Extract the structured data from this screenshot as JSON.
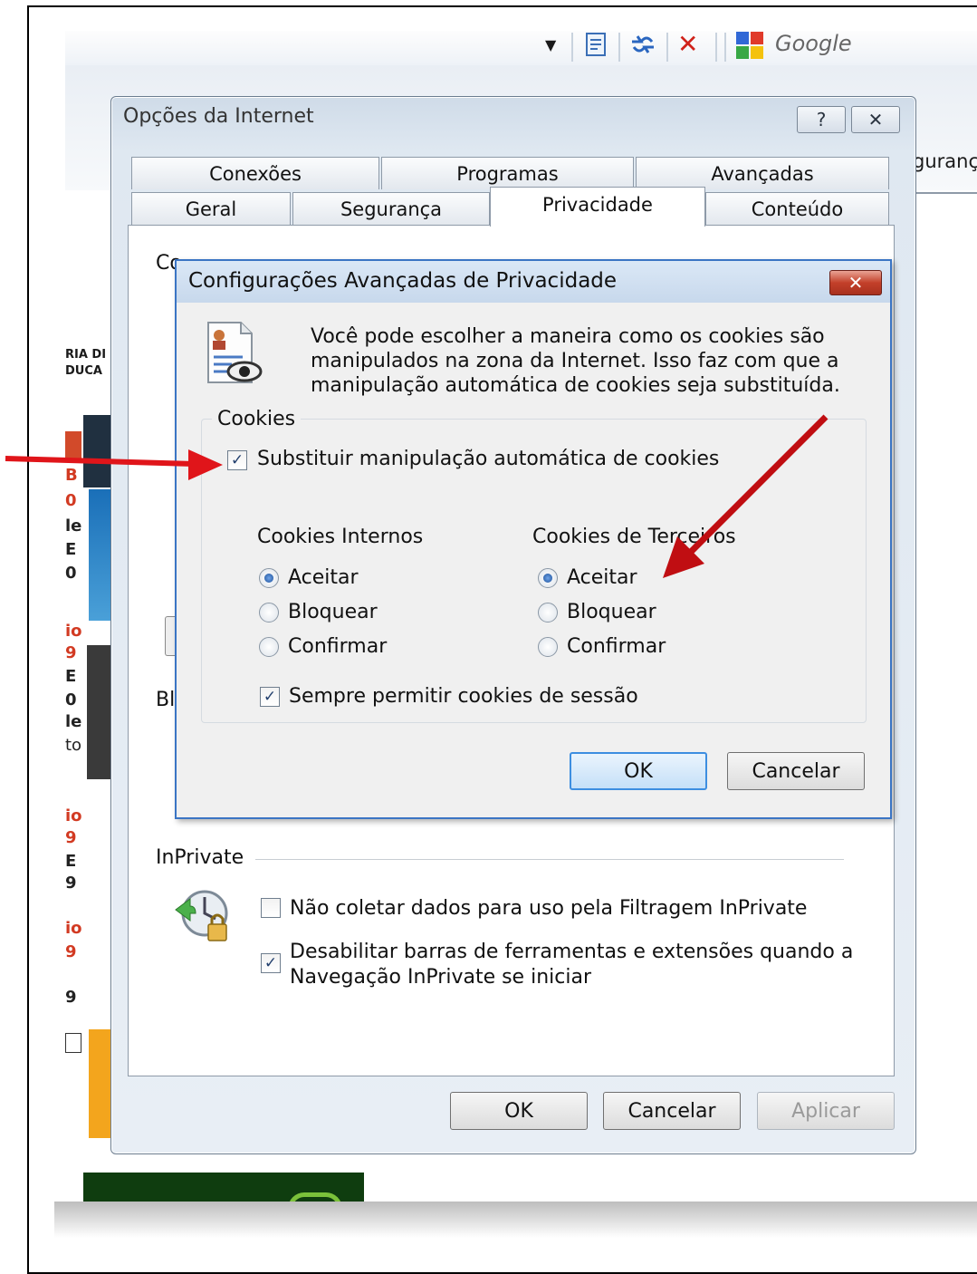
{
  "browser": {
    "search_engine_label": "Google",
    "partial_tab_text": "guranç",
    "background_fragments": [
      "RIA DI",
      "DUCA",
      "B",
      "0",
      "le",
      "E",
      "0",
      "io",
      "9",
      "E",
      "0",
      "le",
      "to",
      "io",
      "9",
      "E",
      "9",
      "io",
      "9",
      "9"
    ]
  },
  "main_dialog": {
    "title": "Opções da Internet",
    "help_label": "?",
    "close_label": "✕",
    "tabs_row1": [
      "Conexões",
      "Programas",
      "Avançadas"
    ],
    "tabs_row2": [
      "Geral",
      "Segurança",
      "Privacidade",
      "Conteúdo"
    ],
    "selected_tab": "Privacidade",
    "partial_settings_text": "Co",
    "partial_bl_text": "Bl",
    "inprivate": {
      "heading": "InPrivate",
      "option1": {
        "label": "Não coletar dados para uso pela Filtragem InPrivate",
        "checked": false
      },
      "option2": {
        "line1": "Desabilitar barras de ferramentas e extensões quando a",
        "line2": "Navegação InPrivate se iniciar",
        "checked": true
      }
    },
    "buttons": {
      "ok": "OK",
      "cancel": "Cancelar",
      "apply": "Aplicar"
    }
  },
  "privacy_dialog": {
    "title": "Configurações Avançadas de Privacidade",
    "close_label": "✕",
    "description": [
      "Você pode escolher a maneira como os cookies são",
      "manipulados na zona da Internet. Isso faz com que a",
      "manipulação automática de cookies seja substituída."
    ],
    "group_label": "Cookies",
    "override_checkbox": {
      "label": "Substituir manipulação automática de cookies",
      "checked": true
    },
    "first_party": {
      "heading": "Cookies Internos",
      "options": [
        "Aceitar",
        "Bloquear",
        "Confirmar"
      ],
      "selected": "Aceitar"
    },
    "third_party": {
      "heading": "Cookies de Terceiros",
      "options": [
        "Aceitar",
        "Bloquear",
        "Confirmar"
      ],
      "selected": "Aceitar"
    },
    "session_checkbox": {
      "label": "Sempre permitir cookies de sessão",
      "checked": true
    },
    "buttons": {
      "ok": "OK",
      "cancel": "Cancelar"
    }
  },
  "colors": {
    "arrow": "#e0151a",
    "arrow_dark": "#c00e12",
    "dialog_border": "#3b75c4"
  }
}
